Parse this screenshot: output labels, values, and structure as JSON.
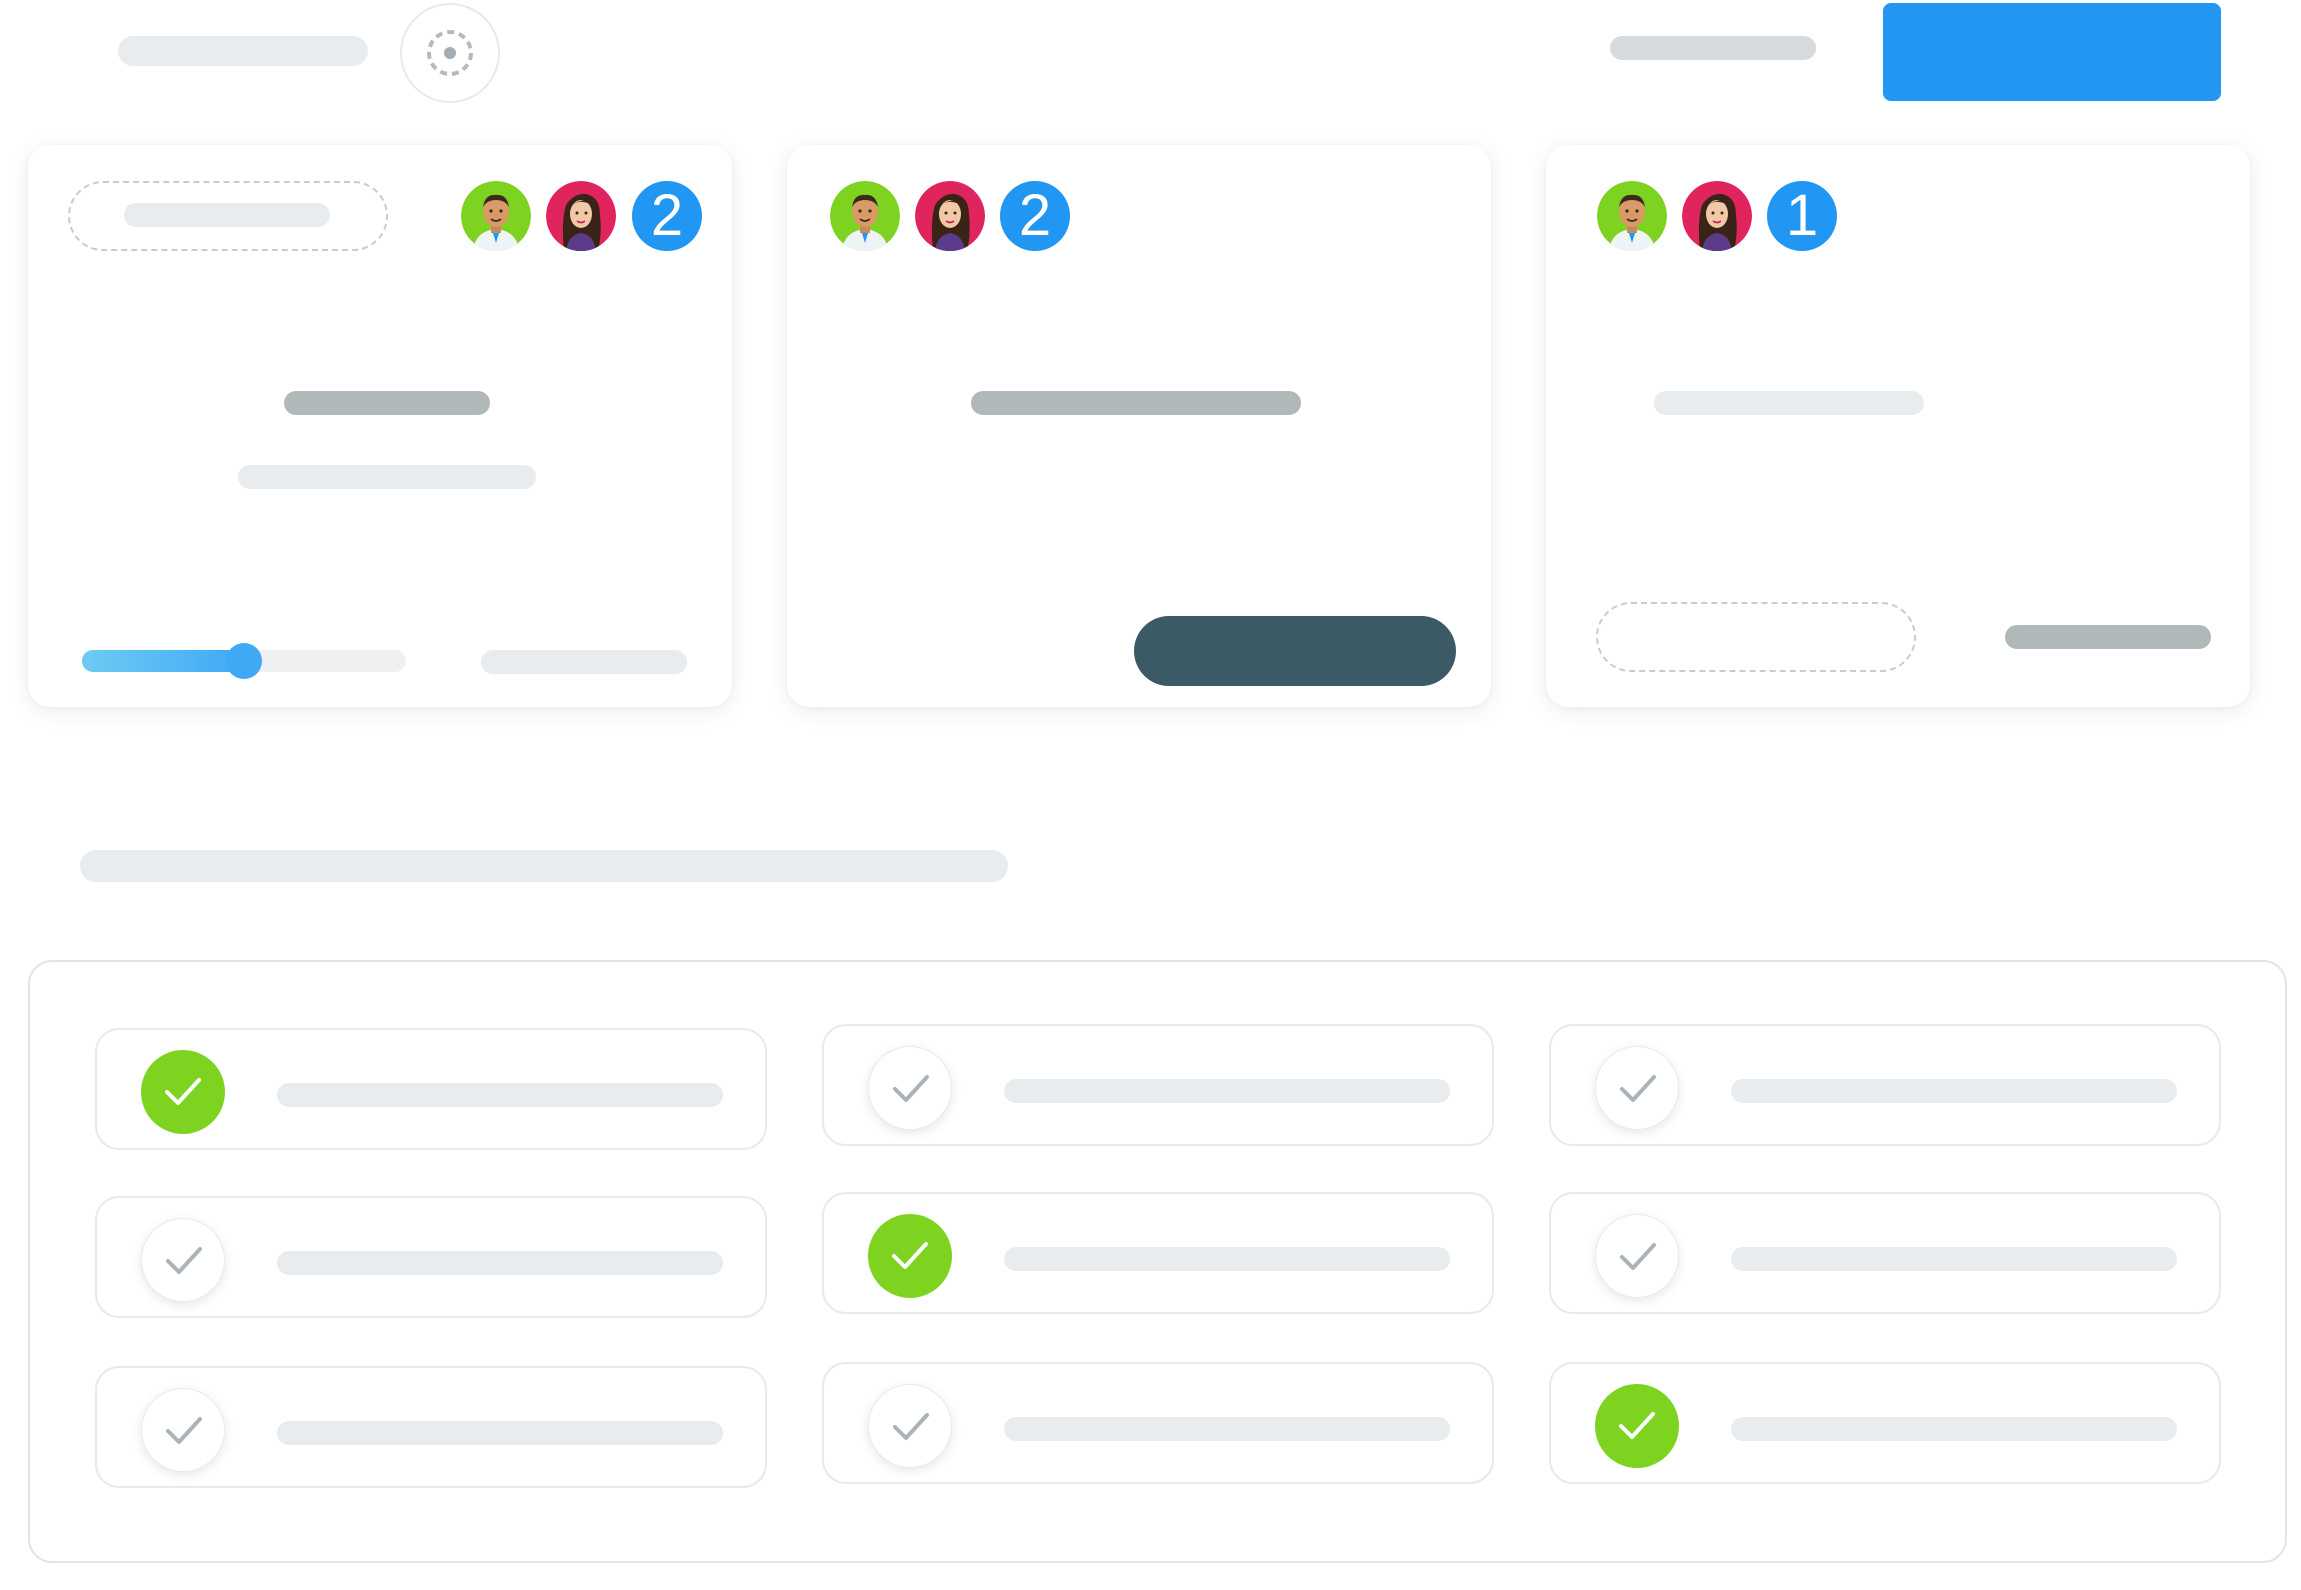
{
  "colors": {
    "primary_button": "#2196f3",
    "badge_blue": "#2196f3",
    "check_done": "#7ed321",
    "dark_button": "#3b5a66",
    "slider_start": "#6ecbf5",
    "slider_end": "#3fa9f5",
    "avatar_male_bg": "#7ed321",
    "avatar_female_bg": "#e0245e"
  },
  "header": {
    "settings_icon": "dashed-circle-target-icon"
  },
  "cards": [
    {
      "badge_count": "2",
      "slider_value": 0.47
    },
    {
      "badge_count": "2"
    },
    {
      "badge_count": "1"
    }
  ],
  "checklist": {
    "items": [
      {
        "done": true
      },
      {
        "done": false
      },
      {
        "done": false
      },
      {
        "done": false
      },
      {
        "done": true
      },
      {
        "done": false
      },
      {
        "done": false
      },
      {
        "done": false
      },
      {
        "done": true
      }
    ]
  }
}
